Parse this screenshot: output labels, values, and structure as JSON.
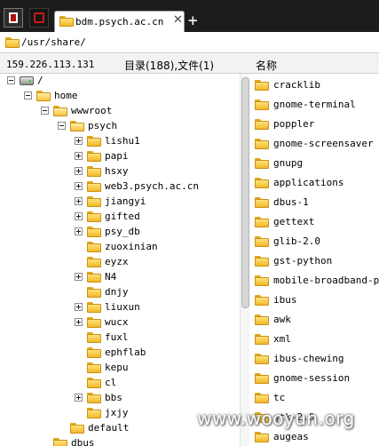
{
  "tab": {
    "title": "bdm.psych.ac.cn",
    "close_glyph": "✕",
    "new_tab_glyph": "+"
  },
  "toolbar": {
    "icons": [
      "app-menu-icon",
      "screenshot-icon"
    ]
  },
  "pathbar": {
    "path": "/usr/share/"
  },
  "infobar": {
    "host": "159.226.113.131",
    "summary": "目录(188),文件(1)",
    "column_name": "名称"
  },
  "tree": [
    {
      "depth": 0,
      "label": "/",
      "icon": "drive-icon",
      "state": "expanded"
    },
    {
      "depth": 1,
      "label": "home",
      "icon": "folder-open-icon",
      "state": "expanded"
    },
    {
      "depth": 2,
      "label": "wwwroot",
      "icon": "folder-open-icon",
      "state": "expanded"
    },
    {
      "depth": 3,
      "label": "psych",
      "icon": "folder-open-icon",
      "state": "expanded"
    },
    {
      "depth": 4,
      "label": "lishu1",
      "icon": "folder-icon",
      "state": "collapsed"
    },
    {
      "depth": 4,
      "label": "papi",
      "icon": "folder-icon",
      "state": "collapsed"
    },
    {
      "depth": 4,
      "label": "hsxy",
      "icon": "folder-icon",
      "state": "collapsed"
    },
    {
      "depth": 4,
      "label": "web3.psych.ac.cn",
      "icon": "folder-icon",
      "state": "collapsed"
    },
    {
      "depth": 4,
      "label": "jiangyi",
      "icon": "folder-icon",
      "state": "collapsed"
    },
    {
      "depth": 4,
      "label": "gifted",
      "icon": "folder-icon",
      "state": "collapsed"
    },
    {
      "depth": 4,
      "label": "psy_db",
      "icon": "folder-icon",
      "state": "collapsed"
    },
    {
      "depth": 4,
      "label": "zuoxinian",
      "icon": "folder-icon",
      "state": "leaf"
    },
    {
      "depth": 4,
      "label": "eyzx",
      "icon": "folder-icon",
      "state": "leaf"
    },
    {
      "depth": 4,
      "label": "N4",
      "icon": "folder-icon",
      "state": "collapsed"
    },
    {
      "depth": 4,
      "label": "dnjy",
      "icon": "folder-icon",
      "state": "leaf"
    },
    {
      "depth": 4,
      "label": "liuxun",
      "icon": "folder-icon",
      "state": "collapsed"
    },
    {
      "depth": 4,
      "label": "wucx",
      "icon": "folder-icon",
      "state": "collapsed"
    },
    {
      "depth": 4,
      "label": "fuxl",
      "icon": "folder-icon",
      "state": "leaf"
    },
    {
      "depth": 4,
      "label": "ephflab",
      "icon": "folder-icon",
      "state": "leaf"
    },
    {
      "depth": 4,
      "label": "kepu",
      "icon": "folder-icon",
      "state": "leaf"
    },
    {
      "depth": 4,
      "label": "cl",
      "icon": "folder-icon",
      "state": "leaf"
    },
    {
      "depth": 4,
      "label": "bbs",
      "icon": "folder-icon",
      "state": "collapsed"
    },
    {
      "depth": 4,
      "label": "jxjy",
      "icon": "folder-icon",
      "state": "leaf"
    },
    {
      "depth": 3,
      "label": "default",
      "icon": "folder-icon",
      "state": "leaf"
    },
    {
      "depth": 2,
      "label": "dbus",
      "icon": "folder-icon",
      "state": "leaf"
    }
  ],
  "listing": [
    "cracklib",
    "gnome-terminal",
    "poppler",
    "gnome-screensaver",
    "gnupg",
    "applications",
    "dbus-1",
    "gettext",
    "glib-2.0",
    "gst-python",
    "mobile-broadband-pro",
    "ibus",
    "awk",
    "xml",
    "ibus-chewing",
    "gnome-session",
    "tc",
    "gtk-2.0",
    "augeas"
  ],
  "watermark": "www.wooyun.org",
  "colors": {
    "tabstrip": "#1c1c1c",
    "folder": "#f2b827",
    "accent_red": "#c81818"
  }
}
